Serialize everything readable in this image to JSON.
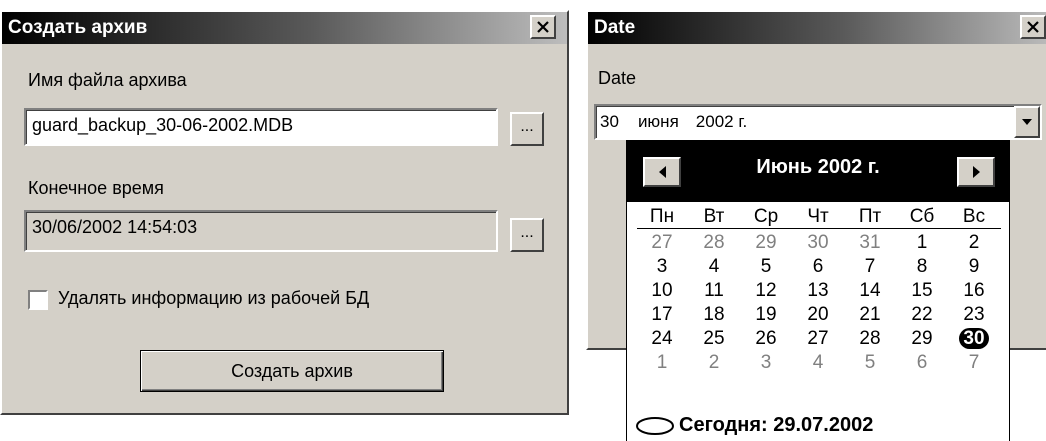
{
  "archive_dialog": {
    "title": "Создать архив",
    "filename_label": "Имя файла архива",
    "filename_value": "guard_backup_30-06-2002.MDB",
    "browse_label": "...",
    "endtime_label": "Конечное время",
    "endtime_value": "30/06/2002 14:54:03",
    "endtime_button": "...",
    "delete_checkbox_label": "Удалять информацию из рабочей БД",
    "create_button": "Создать архив"
  },
  "date_dialog": {
    "title": "Date",
    "date_label": "Date",
    "combo_day": "30",
    "combo_month": "июня",
    "combo_year": "2002 г."
  },
  "calendar": {
    "month_title": "Июнь 2002 г.",
    "weekdays": [
      "Пн",
      "Вт",
      "Ср",
      "Чт",
      "Пт",
      "Сб",
      "Вс"
    ],
    "weeks": [
      [
        "27",
        "28",
        "29",
        "30",
        "31",
        "1",
        "2"
      ],
      [
        "3",
        "4",
        "5",
        "6",
        "7",
        "8",
        "9"
      ],
      [
        "10",
        "11",
        "12",
        "13",
        "14",
        "15",
        "16"
      ],
      [
        "17",
        "18",
        "19",
        "20",
        "21",
        "22",
        "23"
      ],
      [
        "24",
        "25",
        "26",
        "27",
        "28",
        "29",
        "30"
      ],
      [
        "1",
        "2",
        "3",
        "4",
        "5",
        "6",
        "7"
      ]
    ],
    "today_label": "Сегодня: 29.07.2002"
  }
}
